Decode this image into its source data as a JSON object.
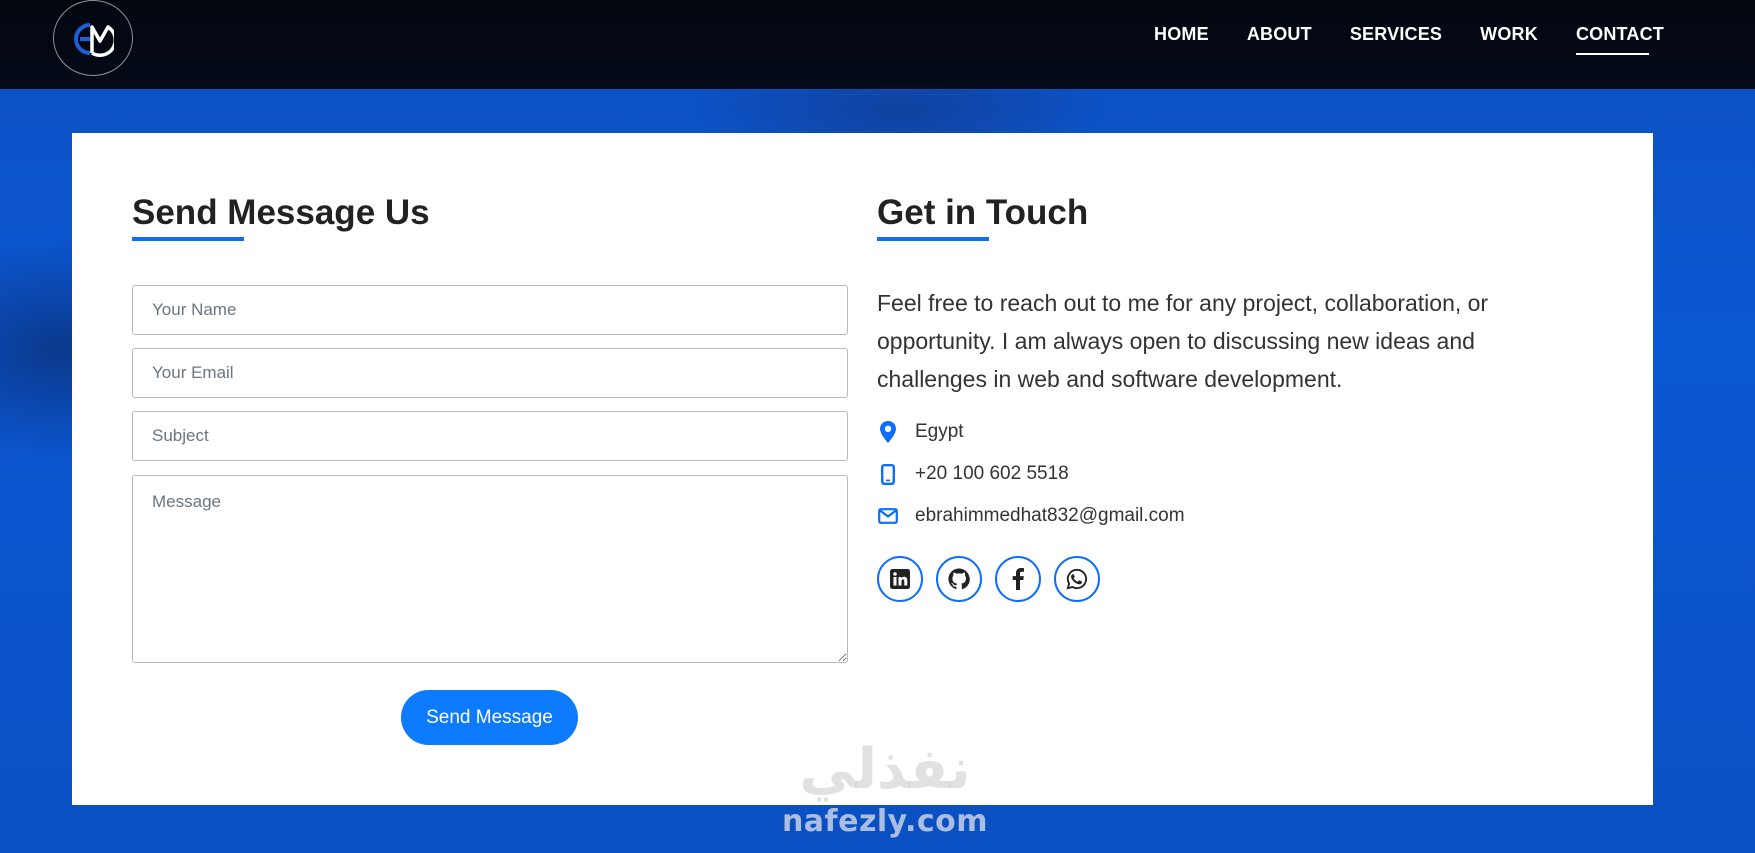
{
  "nav": {
    "logo_icon": "em-monogram-logo",
    "links": [
      {
        "label": "HOME"
      },
      {
        "label": "ABOUT"
      },
      {
        "label": "SERVICES"
      },
      {
        "label": "WORK"
      },
      {
        "label": "CONTACT",
        "active": true
      }
    ]
  },
  "form": {
    "title": "Send Message Us",
    "name_placeholder": "Your Name",
    "email_placeholder": "Your Email",
    "subject_placeholder": "Subject",
    "message_placeholder": "Message",
    "submit_label": "Send Message"
  },
  "contact": {
    "title": "Get in Touch",
    "intro": "Feel free to reach out to me for any project, collaboration, or opportunity. I am always open to discussing new ideas and challenges in web and software development.",
    "location": "Egypt",
    "phone": "+20 100 602 5518",
    "email": "ebrahimmedhat832@gmail.com",
    "socials": [
      {
        "icon": "linkedin-icon"
      },
      {
        "icon": "github-icon"
      },
      {
        "icon": "facebook-icon"
      },
      {
        "icon": "whatsapp-icon"
      }
    ]
  },
  "watermark": {
    "arabic": "نفذلي",
    "latin": "nafezly.com"
  },
  "colors": {
    "accent": "#0d6efd",
    "button": "#0d7bff",
    "navbar": "#02060f",
    "background": "#0a53c7"
  }
}
